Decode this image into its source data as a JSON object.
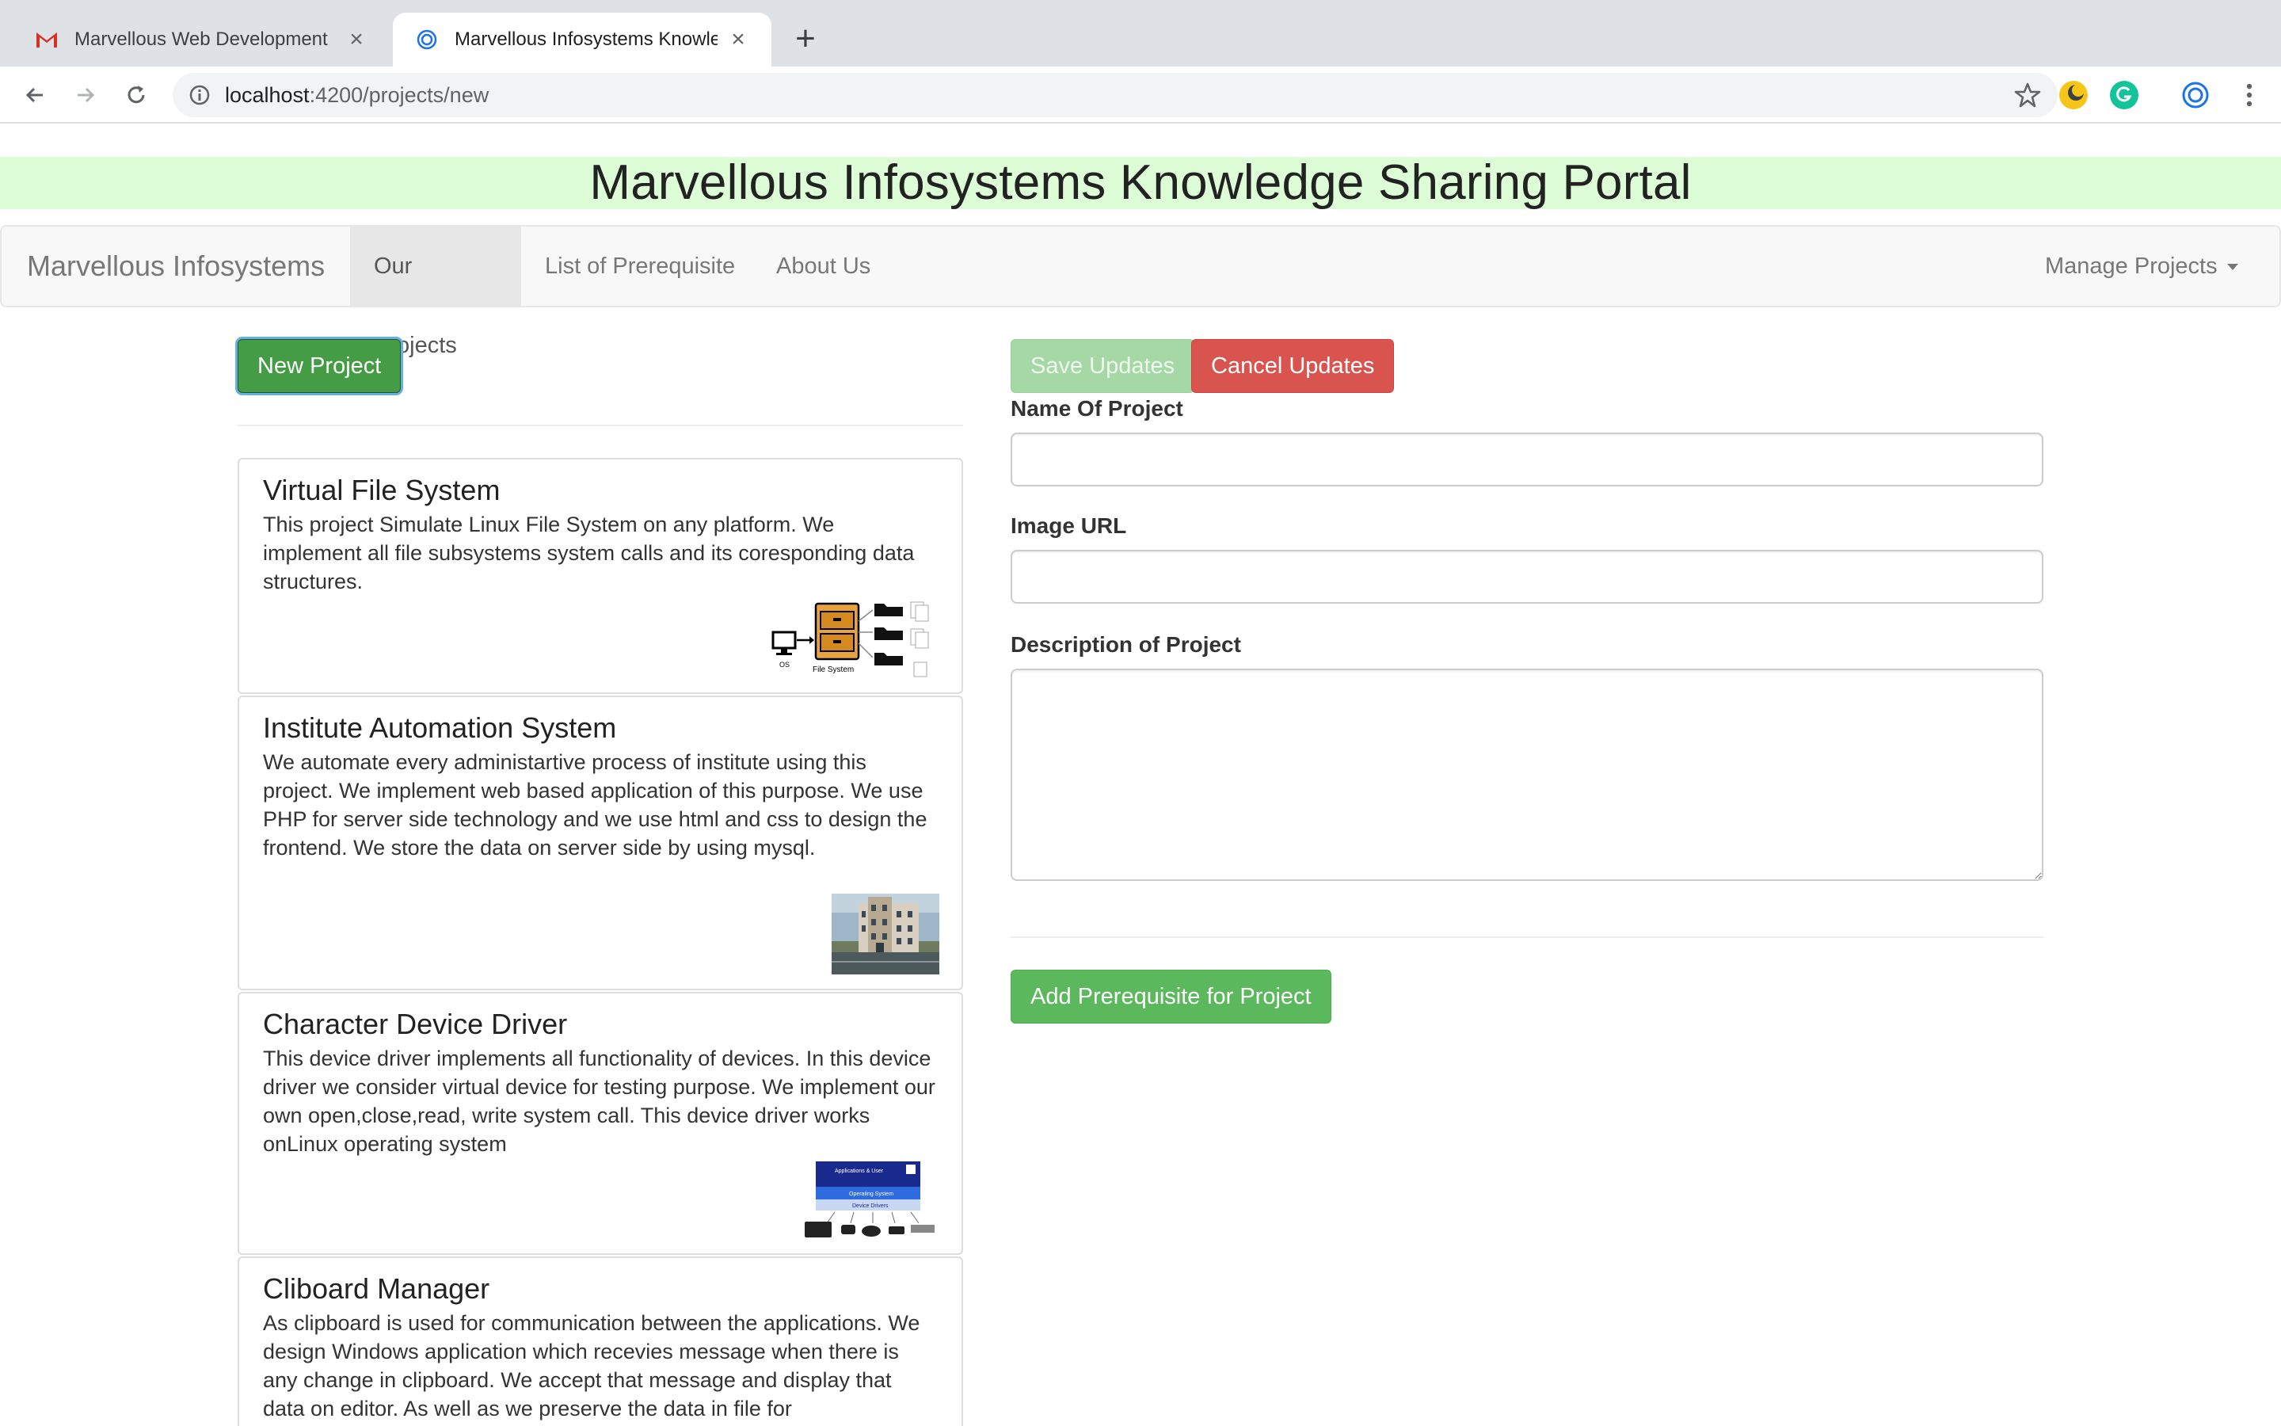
{
  "browser": {
    "tabs": [
      {
        "title": "Marvellous Web Development",
        "active": false,
        "icon": "gmail-icon"
      },
      {
        "title": "Marvellous Infosystems Knowle",
        "active": true,
        "icon": "app-icon"
      }
    ],
    "url_host": "localhost",
    "url_path": ":4200/projects/new"
  },
  "banner": {
    "title": "Marvellous Infosystems Knowledge Sharing Portal"
  },
  "navbar": {
    "brand": "Marvellous Infosystems",
    "items": [
      {
        "label": "Our Projects",
        "active": true
      },
      {
        "label": "List of Prerequisite",
        "active": false
      },
      {
        "label": "About Us",
        "active": false
      }
    ],
    "dropdown": "Manage Projects"
  },
  "left": {
    "new_project_label": "New Project",
    "projects": [
      {
        "title": "Virtual File System",
        "description": "This project Simulate Linux File System on any platform. We implement all file subsystems system calls and its coresponding data structures.",
        "image": "file-system-diagram",
        "image_labels": {
          "os": "OS",
          "fs": "File System"
        }
      },
      {
        "title": "Institute Automation System",
        "description": "We automate every administartive process of institute using this project. We implement web based application of this purpose. We use PHP for server side technology and we use html and css to design the frontend. We store the data on server side by using mysql.",
        "image": "building-photo"
      },
      {
        "title": "Character Device Driver",
        "description": "This device driver implements all functionality of devices. In this device driver we consider virtual device for testing purpose. We implement our own open,close,read, write system call. This device driver works onLinux operating system",
        "image": "device-driver-diagram",
        "image_labels": {
          "top": "Applications & User",
          "mid": "Operating System",
          "bottom": "Device Drivers"
        }
      },
      {
        "title": "Cliboard Manager",
        "description": "As clipboard is used for communication between the applications. We design Windows application which recevies message when there is any change in clipboard. We accept that message and display that data on editor. As well as we preserve the data in file for",
        "image": ""
      }
    ]
  },
  "form": {
    "save_label": "Save Updates",
    "cancel_label": "Cancel Updates",
    "name_label": "Name Of Project",
    "name_value": "",
    "image_label": "Image URL",
    "image_value": "",
    "description_label": "Description of Project",
    "description_value": "",
    "add_prereq_label": "Add Prerequisite for Project"
  },
  "colors": {
    "banner_bg": "#ddfdd7",
    "success": "#5cb85c",
    "danger": "#d9534f"
  }
}
